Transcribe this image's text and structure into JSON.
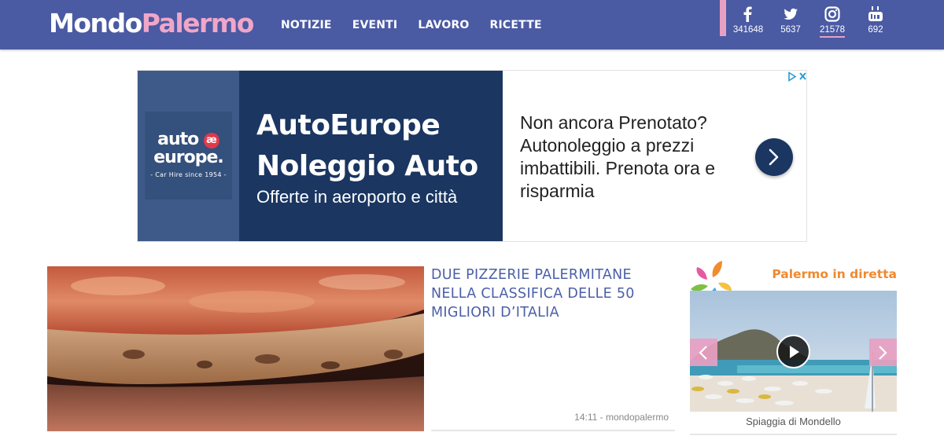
{
  "header": {
    "logo_part1": "Mondo",
    "logo_part2": "Palermo",
    "nav": [
      "NOTIZIE",
      "EVENTI",
      "LAVORO",
      "RICETTE"
    ],
    "social": [
      {
        "icon": "facebook-icon",
        "count": "341648"
      },
      {
        "icon": "twitter-icon",
        "count": "5637"
      },
      {
        "icon": "instagram-icon",
        "count": "21578"
      },
      {
        "icon": "youtube-icon",
        "count": "692"
      }
    ]
  },
  "ad": {
    "brand_line1": "auto",
    "brand_mark": "æ",
    "brand_line2": "europe.",
    "brand_tagline": "- Car Hire since 1954 -",
    "title_line1": "AutoEurope",
    "title_line2": "Noleggio Auto",
    "subtitle": "Offerte in aeroporto e città",
    "body": "Non ancora Prenotato? Autonoleggio a prezzi imbattibili. Prenota ora e risparmia"
  },
  "article": {
    "title": "DUE PIZZERIE PALERMITANE NELLA CLASSIFICA DELLE 50 MIGLIORI D’ITALIA",
    "meta": "14:11 - mondopalermo"
  },
  "live": {
    "title": "Palermo in diretta",
    "caption": "Spiaggia di Mondello"
  },
  "colors": {
    "header_bg": "#4a5aa3",
    "logo_accent": "#f0a6c8",
    "article_title": "#4b5fa8",
    "live_title": "#f0892f",
    "ad_dark": "#1a3661"
  }
}
